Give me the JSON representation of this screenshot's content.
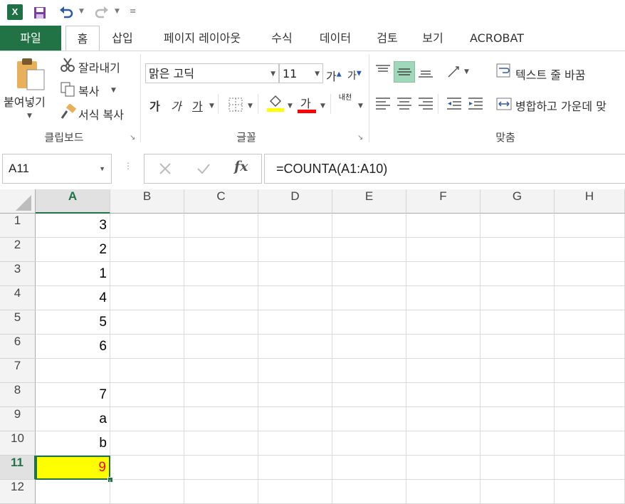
{
  "app": {
    "logo_letter": "X"
  },
  "ribbon_tabs": [
    {
      "label": "파일"
    },
    {
      "label": "홈"
    },
    {
      "label": "삽입"
    },
    {
      "label": "페이지 레이아웃"
    },
    {
      "label": "수식"
    },
    {
      "label": "데이터"
    },
    {
      "label": "검토"
    },
    {
      "label": "보기"
    },
    {
      "label": "ACROBAT"
    }
  ],
  "clipboard": {
    "paste_label": "붙여넣기",
    "cut_label": "잘라내기",
    "copy_label": "복사",
    "format_painter_label": "서식 복사",
    "group_label": "클립보드"
  },
  "font": {
    "font_name": "맑은 고딕",
    "font_size": "11",
    "grow_label": "가",
    "shrink_label": "가",
    "bold_label": "가",
    "italic_label": "가",
    "underline_label": "가",
    "font_color_label": "가",
    "phonetic_label": "내천",
    "group_label": "글꼴",
    "highlight_color": "#ffff00",
    "font_color": "#ff0000"
  },
  "alignment": {
    "wrap_text_label": "텍스트 줄 바꿈",
    "merge_center_label": "병합하고 가운데 맞",
    "group_label": "맞춤"
  },
  "formula_bar": {
    "name_box": "A11",
    "formula": "=COUNTA(A1:A10)"
  },
  "sheet": {
    "columns": [
      "A",
      "B",
      "C",
      "D",
      "E",
      "F",
      "G",
      "H"
    ],
    "rows": [
      "1",
      "2",
      "3",
      "4",
      "5",
      "6",
      "7",
      "8",
      "9",
      "10",
      "11",
      "12"
    ],
    "a_values": [
      "3",
      "2",
      "1",
      "4",
      "5",
      "6",
      "",
      "7",
      "a",
      "b",
      "9",
      ""
    ],
    "selected_cell": "A11",
    "selected_fill": "#ffff00",
    "selected_text_color": "#ff0000",
    "accent": "#217346"
  }
}
